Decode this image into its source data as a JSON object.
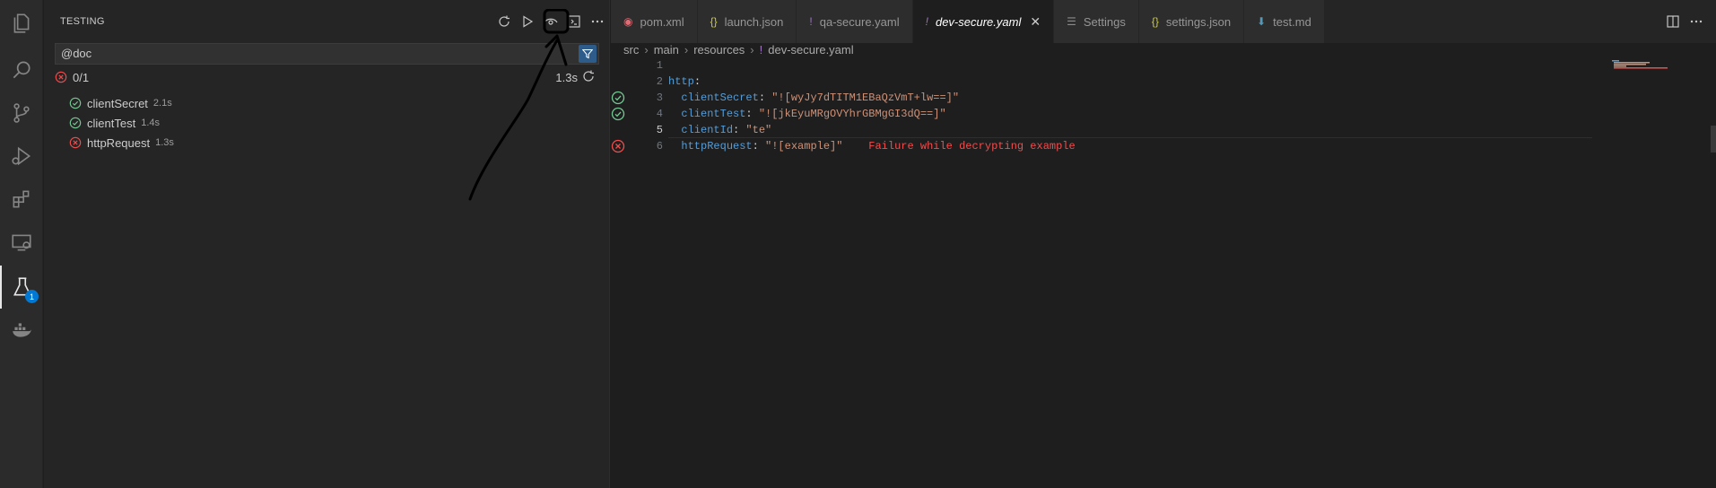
{
  "sidebar": {
    "title": "TESTING",
    "actions": [
      "refresh-icon",
      "run-all-icon",
      "eye-icon",
      "terminal-icon",
      "more-icon"
    ],
    "filter": {
      "value": "@doc"
    },
    "summary": {
      "count": "0/1",
      "duration": "1.3s"
    },
    "tests": [
      {
        "name": "clientSecret",
        "duration": "2.1s",
        "status": "passed"
      },
      {
        "name": "clientTest",
        "duration": "1.4s",
        "status": "passed"
      },
      {
        "name": "httpRequest",
        "duration": "1.3s",
        "status": "failed"
      }
    ]
  },
  "activity_bar": {
    "items": [
      "files-icon",
      "search-icon",
      "source-control-icon",
      "run-debug-icon",
      "extensions-icon",
      "remote-explorer-icon",
      "testing-icon",
      "docker-icon"
    ],
    "testing_badge": "1"
  },
  "editor": {
    "tabs": [
      {
        "label": "pom.xml",
        "icon": "xml-icon",
        "active": false
      },
      {
        "label": "launch.json",
        "icon": "json-icon",
        "active": false
      },
      {
        "label": "qa-secure.yaml",
        "icon": "yaml-icon",
        "active": false
      },
      {
        "label": "dev-secure.yaml",
        "icon": "yaml-icon",
        "active": true
      },
      {
        "label": "Settings",
        "icon": "settings-icon",
        "active": false
      },
      {
        "label": "settings.json",
        "icon": "json-icon",
        "active": false
      },
      {
        "label": "test.md",
        "icon": "markdown-icon",
        "active": false
      }
    ],
    "breadcrumb": [
      "src",
      "main",
      "resources",
      "dev-secure.yaml"
    ],
    "lines": [
      {
        "n": "1",
        "text": ""
      },
      {
        "n": "2",
        "key": "http",
        "text": ":"
      },
      {
        "n": "3",
        "key": "clientSecret",
        "value": "\"![wyJy7dTITM1EBaQzVmT+lw==]\"",
        "status": "passed"
      },
      {
        "n": "4",
        "key": "clientTest",
        "value": "\"![jkEyuMRgOVYhrGBMgGI3dQ==]\"",
        "status": "passed"
      },
      {
        "n": "5",
        "key": "clientId",
        "value": "\"te\""
      },
      {
        "n": "6",
        "key": "httpRequest",
        "value": "\"![example]\"",
        "status": "failed",
        "error": "Failure while decrypting example"
      }
    ]
  },
  "colors": {
    "pass": "#73c991",
    "fail": "#f14c4c",
    "accent": "#0078d4"
  }
}
